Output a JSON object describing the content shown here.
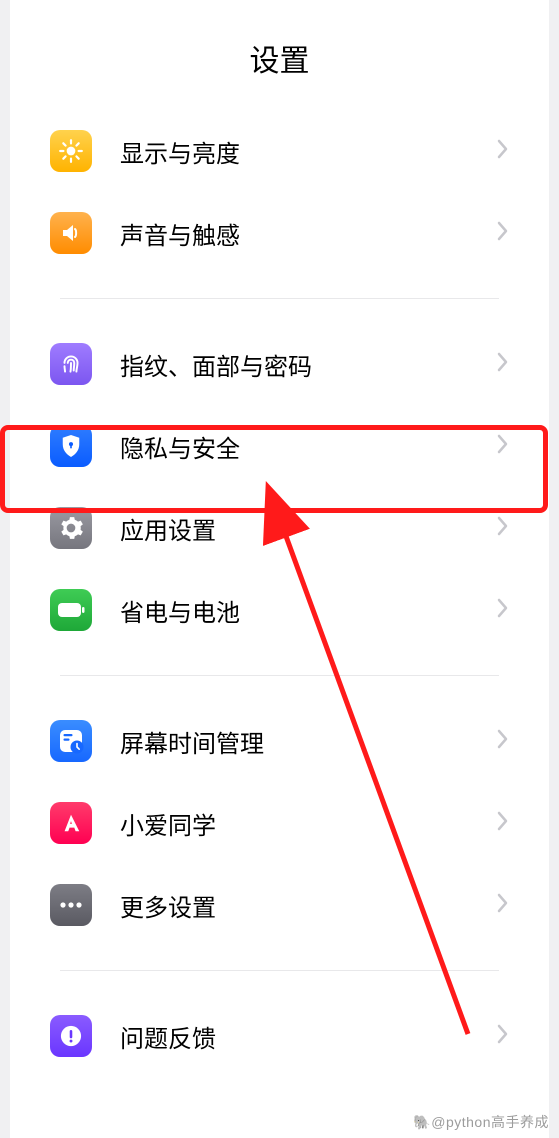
{
  "title": "设置",
  "groups": [
    {
      "items": [
        {
          "id": "display",
          "icon": "sun-icon",
          "iconClass": "ic-display",
          "label": "显示与亮度"
        },
        {
          "id": "sound",
          "icon": "speaker-icon",
          "iconClass": "ic-sound",
          "label": "声音与触感"
        }
      ]
    },
    {
      "items": [
        {
          "id": "biometric",
          "icon": "fingerprint-icon",
          "iconClass": "ic-finger",
          "label": "指纹、面部与密码"
        },
        {
          "id": "privacy",
          "icon": "shield-icon",
          "iconClass": "ic-privacy",
          "label": "隐私与安全"
        },
        {
          "id": "apps",
          "icon": "gear-icon",
          "iconClass": "ic-apps",
          "label": "应用设置"
        },
        {
          "id": "battery",
          "icon": "battery-icon",
          "iconClass": "ic-battery",
          "label": "省电与电池"
        }
      ]
    },
    {
      "items": [
        {
          "id": "screentime",
          "icon": "clock-icon",
          "iconClass": "ic-screen",
          "label": "屏幕时间管理"
        },
        {
          "id": "xiaoai",
          "icon": "ai-icon",
          "iconClass": "ic-xiaoai",
          "label": "小爱同学"
        },
        {
          "id": "more",
          "icon": "dots-icon",
          "iconClass": "ic-more",
          "label": "更多设置"
        }
      ]
    },
    {
      "items": [
        {
          "id": "feedback",
          "icon": "exclamation-icon",
          "iconClass": "ic-feedback",
          "label": "问题反馈"
        }
      ]
    }
  ],
  "highlightedItemId": "privacy",
  "highlightColor": "#ff1a1a",
  "watermark": "🐘@python高手养成"
}
